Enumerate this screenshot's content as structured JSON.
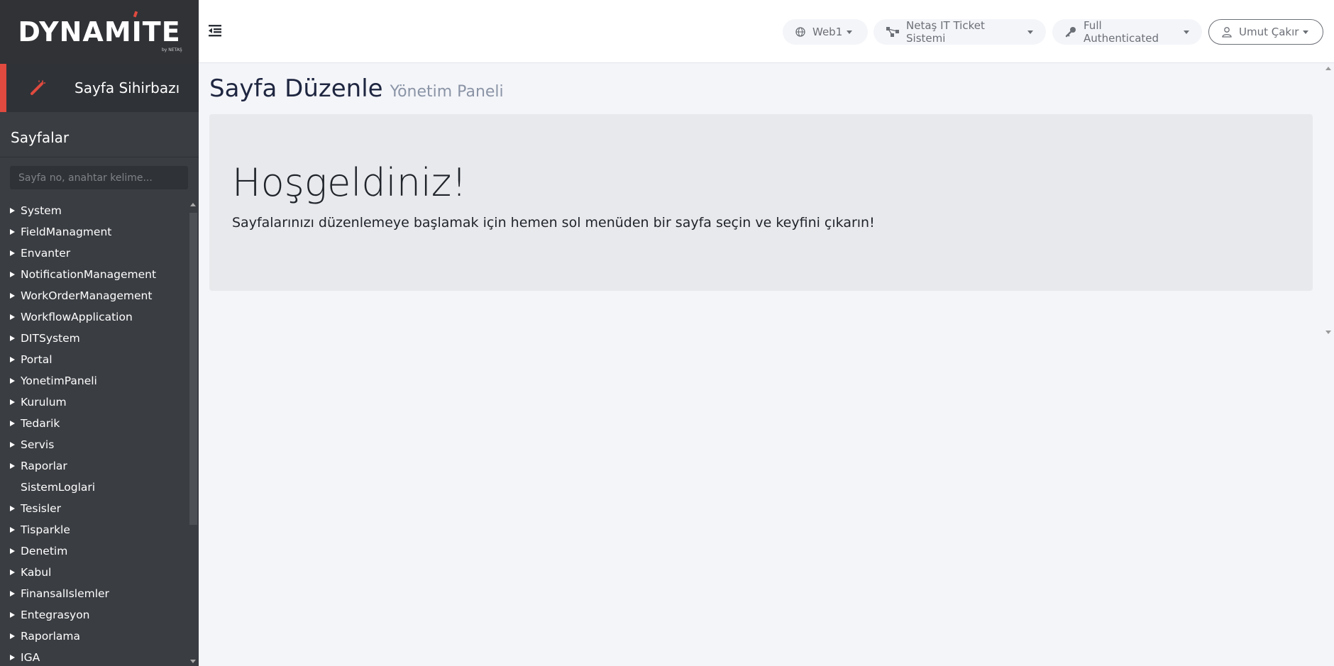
{
  "logo": {
    "text_a": "DYNAM",
    "text_b": "I",
    "text_c": "TE",
    "sub": "by NETAŞ"
  },
  "wizard": {
    "label": "Sayfa Sihirbazı"
  },
  "sidebar": {
    "section_title": "Sayfalar",
    "search_placeholder": "Sayfa no, anahtar kelime...",
    "items": [
      {
        "label": "System",
        "expandable": true
      },
      {
        "label": "FieldManagment",
        "expandable": true
      },
      {
        "label": "Envanter",
        "expandable": true
      },
      {
        "label": "NotificationManagement",
        "expandable": true
      },
      {
        "label": "WorkOrderManagement",
        "expandable": true
      },
      {
        "label": "WorkflowApplication",
        "expandable": true
      },
      {
        "label": "DITSystem",
        "expandable": true
      },
      {
        "label": "Portal",
        "expandable": true
      },
      {
        "label": "YonetimPaneli",
        "expandable": true
      },
      {
        "label": "Kurulum",
        "expandable": true
      },
      {
        "label": "Tedarik",
        "expandable": true
      },
      {
        "label": "Servis",
        "expandable": true
      },
      {
        "label": "Raporlar",
        "expandable": true
      },
      {
        "label": "SistemLoglari",
        "expandable": false
      },
      {
        "label": "Tesisler",
        "expandable": true
      },
      {
        "label": "Tisparkle",
        "expandable": true
      },
      {
        "label": "Denetim",
        "expandable": true
      },
      {
        "label": "Kabul",
        "expandable": true
      },
      {
        "label": "FinansalIslemler",
        "expandable": true
      },
      {
        "label": "Entegrasyon",
        "expandable": true
      },
      {
        "label": "Raporlama",
        "expandable": true
      },
      {
        "label": "IGA",
        "expandable": true
      }
    ]
  },
  "topbar": {
    "web": {
      "label": "Web1",
      "icon": "globe-icon"
    },
    "system": {
      "label": "Netaş IT Ticket Sistemi",
      "icon": "sitemap-icon"
    },
    "auth": {
      "label": "Full Authenticated",
      "icon": "key-icon"
    },
    "user": {
      "label": "Umut Çakır",
      "icon": "user-icon"
    }
  },
  "page": {
    "title": "Sayfa Düzenle",
    "subtitle": "Yönetim Paneli",
    "welcome_title": "Hoşgeldiniz!",
    "welcome_text": "Sayfalarınızı düzenlemeye başlamak için hemen sol menüden bir sayfa seçin ve keyfini çıkarın!"
  },
  "colors": {
    "sidebar_bg": "#3a3d42",
    "accent": "#e04a3f",
    "page_bg": "#f4f5f9",
    "jumbotron_bg": "#e8e9ec"
  }
}
